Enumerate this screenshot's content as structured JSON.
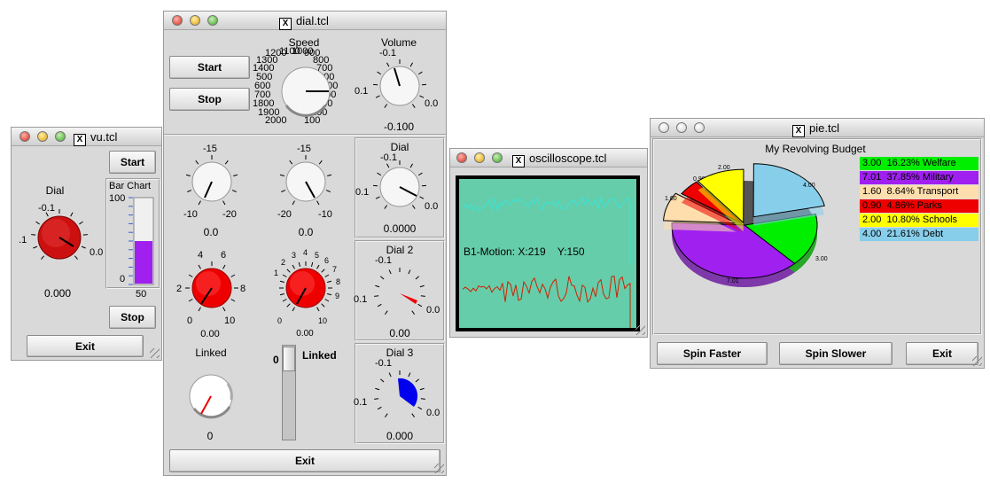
{
  "vu": {
    "title": "vu.tcl",
    "start": "Start",
    "dial_label": "Dial",
    "dial_min": "-0.1",
    "dial_left": "0.1",
    "dial_right": "0.0",
    "dial_value": "0.000",
    "bar_label": "Bar Chart",
    "bar_top": "100",
    "bar_zero": "0",
    "bar_bottom": "50",
    "bar_fill_fraction": 0.5,
    "stop": "Stop",
    "exit": "Exit"
  },
  "dial": {
    "title": "dial.tcl",
    "start": "Start",
    "stop": "Stop",
    "speed_label": "Speed",
    "speed_ticks": [
      "1200",
      "1100",
      "1000",
      "900",
      "1300",
      "800",
      "1400",
      "700",
      "500",
      "600",
      "600",
      "500",
      "700",
      "400",
      "1800",
      "300",
      "1900",
      "200",
      "2000",
      "100"
    ],
    "volume_label": "Volume",
    "volume_min": "-0.1",
    "volume_left": "0.1",
    "volume_right": "0.0",
    "volume_value": "-0.100",
    "knob1_top": "-15",
    "knob1_left": "-10",
    "knob1_right": "-20",
    "knob1_value": "0.0",
    "knob2_top": "-15",
    "knob2_left": "-20",
    "knob2_right": "-10",
    "knob2_value": "0.0",
    "dial_panel_label": "Dial",
    "dial_panel_min": "-0.1",
    "dial_panel_left": "0.1",
    "dial_panel_right": "0.0",
    "dial_panel_value": "0.0000",
    "red1_ticks": [
      "4",
      "6",
      "2",
      "8",
      "0",
      "10"
    ],
    "red1_value": "0.00",
    "red2_ticks": [
      "3",
      "4",
      "5",
      "6",
      "2",
      "7",
      "1",
      "8",
      "9",
      "0",
      "10"
    ],
    "red2_value": "0.00",
    "dial2_label": "Dial 2",
    "dial2_min": "-0.1",
    "dial2_left": "0.1",
    "dial2_right": "0.0",
    "dial2_value": "0.00",
    "linked_label": "Linked",
    "linked_value": "0",
    "scale_value": "0",
    "scale_label": "Linked",
    "dial3_label": "Dial 3",
    "dial3_min": "-0.1",
    "dial3_left": "0.1",
    "dial3_right": "0.0",
    "dial3_value": "0.000",
    "exit": "Exit"
  },
  "osc": {
    "title": "oscilloscope.tcl",
    "motion": "B1-Motion: X:219    Y:150",
    "bg_color": "#66cdaa",
    "trace_top_color": "#40e0d0",
    "trace_bottom_color": "#cc2200"
  },
  "pie": {
    "title": "pie.tcl",
    "chart_data": {
      "type": "pie",
      "title": "My Revolving Budget",
      "slices": [
        {
          "label": "Welfare",
          "value": 3.0,
          "percent": "16.23%",
          "color": "#00ee00"
        },
        {
          "label": "Military",
          "value": 7.01,
          "percent": "37.85%",
          "color": "#a020f0"
        },
        {
          "label": "Transport",
          "value": 1.6,
          "percent": "8.64%",
          "color": "#ffdead"
        },
        {
          "label": "Parks",
          "value": 0.9,
          "percent": "4.86%",
          "color": "#ee0000"
        },
        {
          "label": "Schools",
          "value": 2.0,
          "percent": "10.80%",
          "color": "#ffff00"
        },
        {
          "label": "Debt",
          "value": 4.0,
          "percent": "21.61%",
          "color": "#87ceeb"
        }
      ]
    },
    "legend": [
      {
        "value": "3.00",
        "percent": "16.23%",
        "label": "Welfare"
      },
      {
        "value": "7.01",
        "percent": "37.85%",
        "label": "Military"
      },
      {
        "value": "1.60",
        "percent": "8.64%",
        "label": "Transport"
      },
      {
        "value": "0.90",
        "percent": "4.86%",
        "label": "Parks"
      },
      {
        "value": "2.00",
        "percent": "10.80%",
        "label": "Schools"
      },
      {
        "value": "4.00",
        "percent": "21.61%",
        "label": "Debt"
      }
    ],
    "slice_labels": [
      "3.00",
      "7.01",
      "1.60",
      "0.90",
      "2.00",
      "4.00"
    ],
    "spin_faster": "Spin Faster",
    "spin_slower": "Spin Slower",
    "exit": "Exit"
  }
}
